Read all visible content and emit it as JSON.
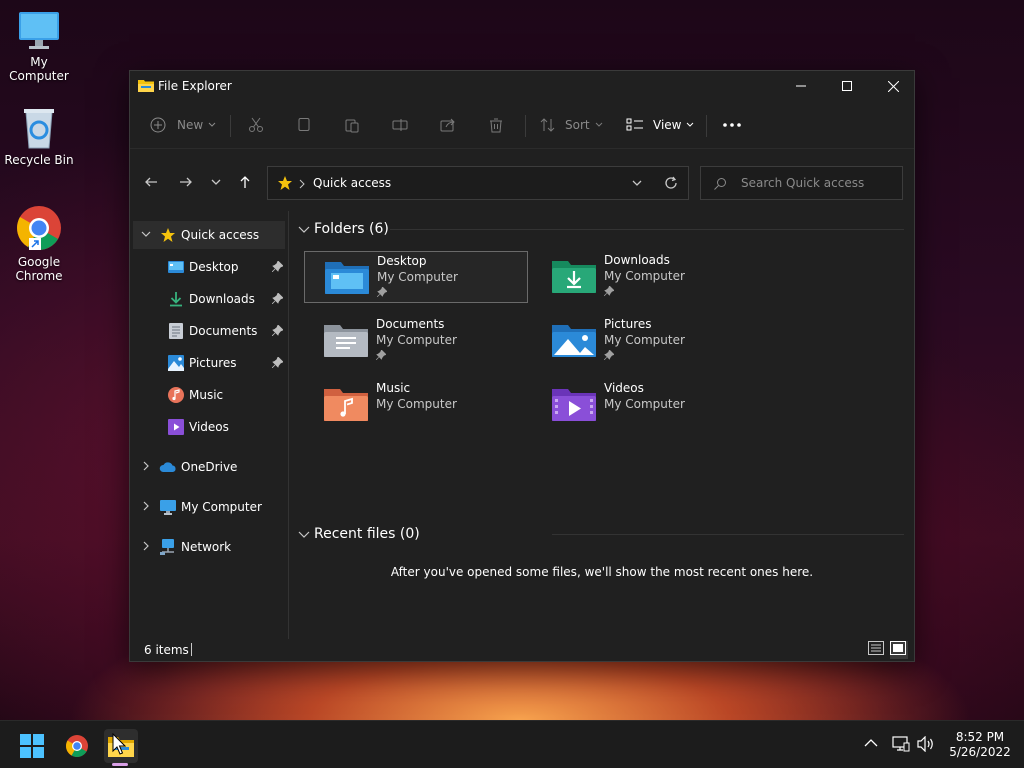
{
  "desktop": {
    "icons": [
      {
        "label": "My Computer"
      },
      {
        "label": "Recycle Bin"
      },
      {
        "label": "Google Chrome"
      }
    ]
  },
  "window": {
    "title": "File Explorer",
    "toolbar": {
      "new_label": "New",
      "sort_label": "Sort",
      "view_label": "View"
    },
    "address": {
      "path": "Quick access"
    },
    "search": {
      "placeholder": "Search Quick access"
    },
    "sidebar": {
      "quick_access": "Quick access",
      "pinned": [
        {
          "label": "Desktop",
          "pinned": true
        },
        {
          "label": "Downloads",
          "pinned": true
        },
        {
          "label": "Documents",
          "pinned": true
        },
        {
          "label": "Pictures",
          "pinned": true
        },
        {
          "label": "Music",
          "pinned": false
        },
        {
          "label": "Videos",
          "pinned": false
        }
      ],
      "onedrive": "OneDrive",
      "my_computer": "My Computer",
      "network": "Network"
    },
    "content": {
      "folders_heading": "Folders (6)",
      "folders": [
        {
          "name": "Desktop",
          "location": "My Computer",
          "pinned": true
        },
        {
          "name": "Downloads",
          "location": "My Computer",
          "pinned": true
        },
        {
          "name": "Documents",
          "location": "My Computer",
          "pinned": true
        },
        {
          "name": "Pictures",
          "location": "My Computer",
          "pinned": true
        },
        {
          "name": "Music",
          "location": "My Computer",
          "pinned": false
        },
        {
          "name": "Videos",
          "location": "My Computer",
          "pinned": false
        }
      ],
      "recent_heading": "Recent files (0)",
      "recent_empty": "After you've opened some files, we'll show the most recent ones here."
    },
    "status": {
      "items": "6 items"
    }
  },
  "taskbar": {
    "time": "8:52 PM",
    "date": "5/26/2022"
  },
  "colors": {
    "window_bg": "#202020",
    "selection": "#2d2d2d",
    "folder_blue": "#2b8ad8",
    "star_yellow": "#f4c20d"
  }
}
